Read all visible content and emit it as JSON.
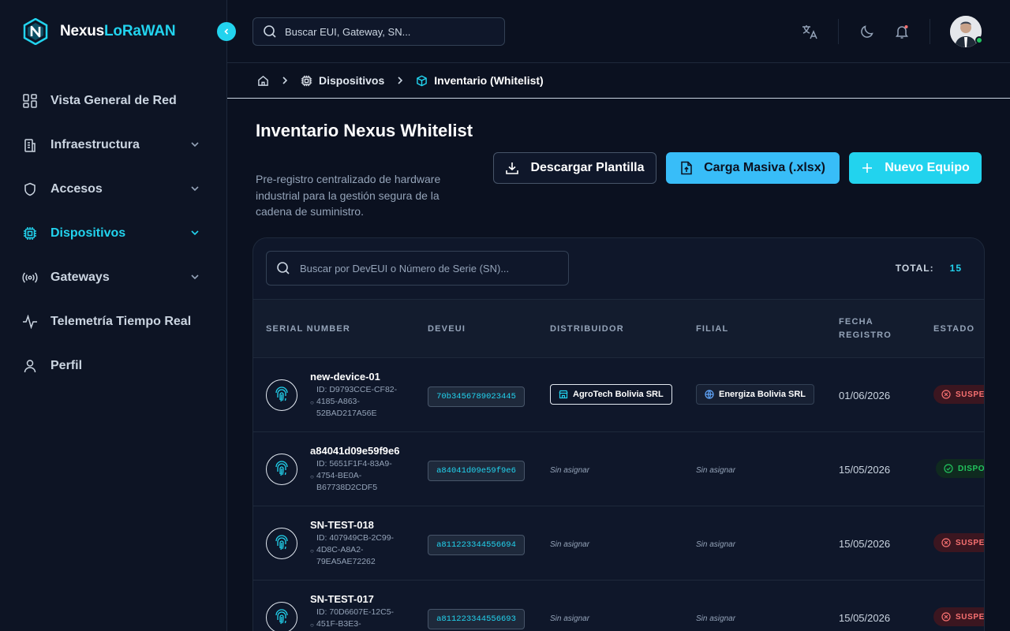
{
  "brand": {
    "part1": "Nexus",
    "part2": "LoRaWAN"
  },
  "sidebar": {
    "items": [
      {
        "label": "Vista General de Red",
        "icon": "grid-icon",
        "expandable": false,
        "active": false
      },
      {
        "label": "Infraestructura",
        "icon": "building-icon",
        "expandable": true,
        "active": false
      },
      {
        "label": "Accesos",
        "icon": "shield-icon",
        "expandable": true,
        "active": false
      },
      {
        "label": "Dispositivos",
        "icon": "chip-icon",
        "expandable": true,
        "active": true
      },
      {
        "label": "Gateways",
        "icon": "broadcast-icon",
        "expandable": true,
        "active": false
      },
      {
        "label": "Telemetría Tiempo Real",
        "icon": "activity-icon",
        "expandable": false,
        "active": false
      },
      {
        "label": "Perfil",
        "icon": "user-icon",
        "expandable": false,
        "active": false
      }
    ]
  },
  "topbar": {
    "search_placeholder": "Buscar EUI, Gateway, SN...",
    "icons": [
      "translate-icon",
      "moon-icon",
      "bell-icon"
    ]
  },
  "breadcrumb": {
    "home_icon": "home-icon",
    "items": [
      "Dispositivos",
      "Inventario (Whitelist)"
    ]
  },
  "page": {
    "title": "Inventario Nexus Whitelist",
    "subtitle": "Pre-registro centralizado de hardware industrial para la gestión segura de la cadena de suministro.",
    "btn_template": "Descargar Plantilla",
    "btn_bulk": "Carga Masiva (.xlsx)",
    "btn_new": "Nuevo Equipo"
  },
  "table": {
    "search_placeholder": "Buscar por DevEUI o Número de Serie (SN)...",
    "total_label": "TOTAL:",
    "total_value": "15",
    "headers": [
      "SERIAL NUMBER",
      "DEVEUI",
      "DISTRIBUIDOR",
      "FILIAL",
      "FECHA REGISTRO",
      "ESTADO"
    ],
    "rows": [
      {
        "name": "new-device-01",
        "id": "ID: D9793CCE-CF82-4185-A863-52BAD217A56E",
        "eui": "70b3456789023445",
        "distributor": "AgroTech Bolivia SRL",
        "filial": "Energiza Bolivia SRL",
        "date": "01/06/2026",
        "status": "SUSPENDIDO",
        "status_kind": "susp"
      },
      {
        "name": "a84041d09e59f9e6",
        "id": "ID: 5651F1F4-83A9-4754-BE0A-B67738D2CDF5",
        "eui": "a84041d09e59f9e6",
        "distributor": "Sin asignar",
        "filial": "Sin asignar",
        "date": "15/05/2026",
        "status": "DISPONIBLE",
        "status_kind": "disp"
      },
      {
        "name": "SN-TEST-018",
        "id": "ID: 407949CB-2C99-4D8C-A8A2-79EA5AE72262",
        "eui": "a811223344556694",
        "distributor": "Sin asignar",
        "filial": "Sin asignar",
        "date": "15/05/2026",
        "status": "SUSPENDIDO",
        "status_kind": "susp"
      },
      {
        "name": "SN-TEST-017",
        "id": "ID: 70D6607E-12C5-451F-B3E3-",
        "eui": "a811223344556693",
        "distributor": "Sin asignar",
        "filial": "Sin asignar",
        "date": "15/05/2026",
        "status": "SUSPENDIDO",
        "status_kind": "susp"
      }
    ]
  },
  "colors": {
    "accent": "#22d3ee",
    "background": "#0b1120",
    "danger": "#f87171",
    "success": "#22c55e"
  }
}
